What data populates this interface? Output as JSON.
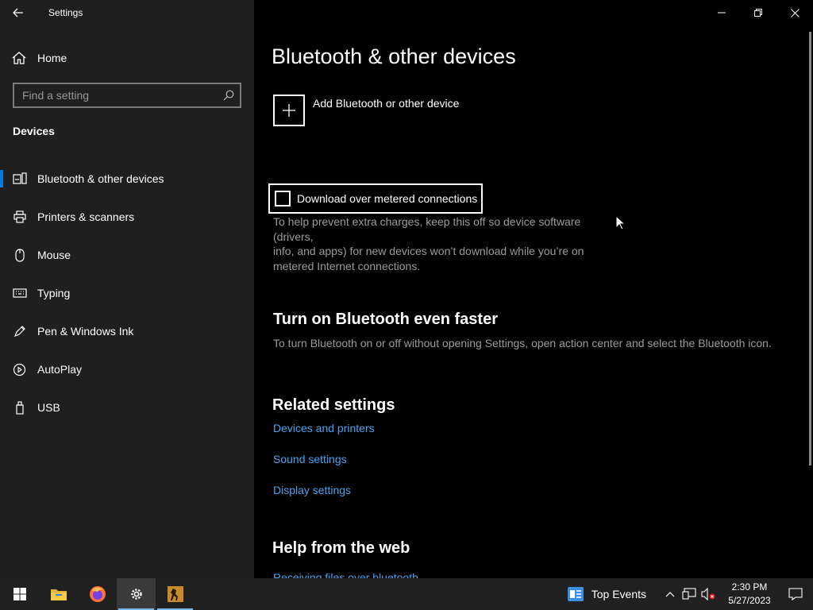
{
  "window": {
    "title": "Settings"
  },
  "sidebar": {
    "home_label": "Home",
    "search_placeholder": "Find a setting",
    "section": "Devices",
    "items": [
      {
        "label": "Bluetooth & other devices",
        "icon": "bluetooth-devices-icon",
        "active": true
      },
      {
        "label": "Printers & scanners",
        "icon": "printer-icon"
      },
      {
        "label": "Mouse",
        "icon": "mouse-icon"
      },
      {
        "label": "Typing",
        "icon": "keyboard-icon"
      },
      {
        "label": "Pen & Windows Ink",
        "icon": "pen-icon"
      },
      {
        "label": "AutoPlay",
        "icon": "autoplay-icon"
      },
      {
        "label": "USB",
        "icon": "usb-icon"
      }
    ]
  },
  "main": {
    "title": "Bluetooth & other devices",
    "add_device_label": "Add Bluetooth or other device",
    "metered_checkbox_label": "Download over metered connections",
    "metered_checked": false,
    "metered_desc_line1": "To help prevent extra charges, keep this off so device software (drivers,",
    "metered_desc_line2": "info, and apps) for new devices won’t download while you’re on",
    "metered_desc_line3": "metered Internet connections.",
    "faster_heading": "Turn on Bluetooth even faster",
    "faster_desc": "To turn Bluetooth on or off without opening Settings, open action center and select the Bluetooth icon.",
    "related_heading": "Related settings",
    "related_links": [
      "Devices and printers",
      "Sound settings",
      "Display settings"
    ],
    "help_heading": "Help from the web",
    "help_link": "Receiving files over bluetooth"
  },
  "taskbar": {
    "weather_label": "Top Events",
    "time": "2:30 PM",
    "date": "5/27/2023"
  },
  "colors": {
    "accent": "#0078d7",
    "link": "#4aa3ef",
    "sidebar_bg": "#1f1f1f",
    "main_bg": "#000000"
  }
}
